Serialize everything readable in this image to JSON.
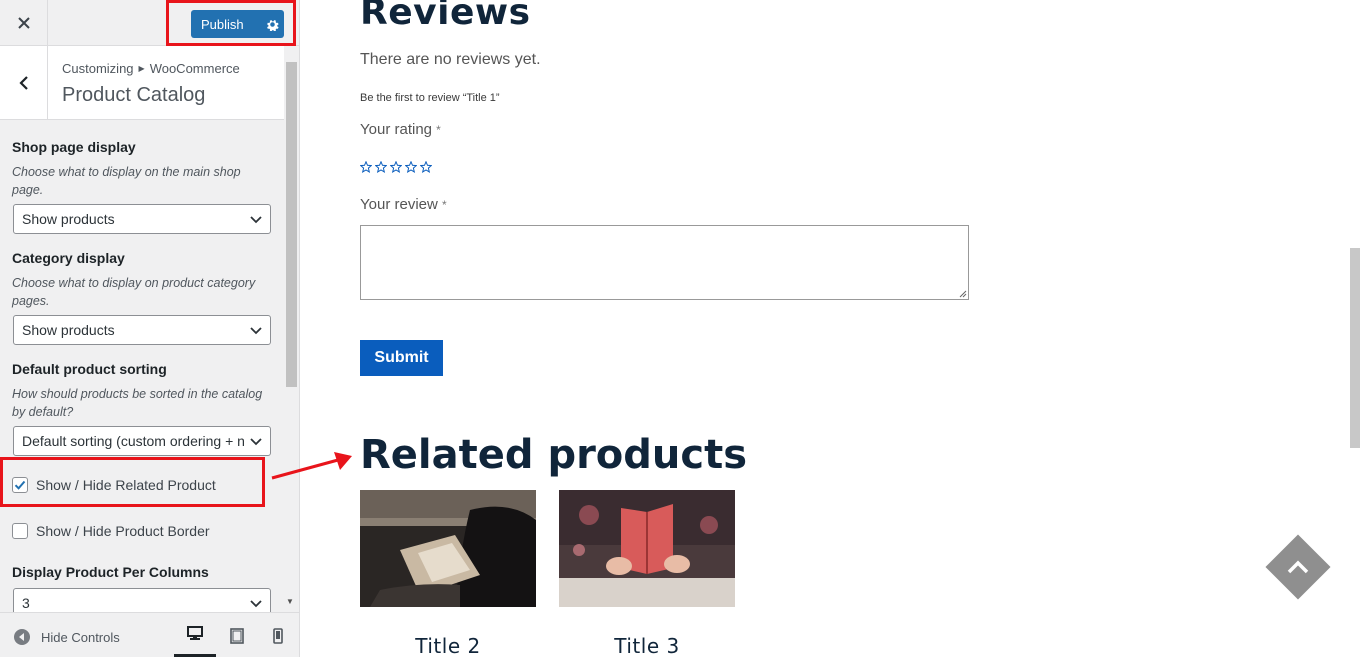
{
  "topbar": {
    "close_icon": "close-icon",
    "publish_label": "Publish",
    "settings_icon": "gear-icon"
  },
  "section": {
    "breadcrumb_root": "Customizing",
    "breadcrumb_parent": "WooCommerce",
    "title": "Product Catalog"
  },
  "controls": {
    "shop_display": {
      "title": "Shop page display",
      "description": "Choose what to display on the main shop page.",
      "value": "Show products"
    },
    "category_display": {
      "title": "Category display",
      "description": "Choose what to display on product category pages.",
      "value": "Show products"
    },
    "sorting": {
      "title": "Default product sorting",
      "description": "How should products be sorted in the catalog by default?",
      "value": "Default sorting (custom ordering + n"
    },
    "related_toggle": {
      "label": "Show / Hide Related Product",
      "checked": true
    },
    "border_toggle": {
      "label": "Show / Hide Product Border",
      "checked": false
    },
    "per_columns": {
      "title": "Display Product Per Columns",
      "value": "3"
    }
  },
  "footer": {
    "hide_controls_label": "Hide Controls",
    "devices": [
      "desktop-icon",
      "tablet-icon",
      "mobile-icon"
    ]
  },
  "preview": {
    "reviews_heading": "Reviews",
    "no_reviews": "There are no reviews yet.",
    "first_review": "Be the first to review “Title 1”",
    "rating_label": "Your rating",
    "review_label": "Your review",
    "required_mark": "*",
    "submit_label": "Submit",
    "related_heading": "Related products",
    "products": [
      {
        "title": "Title 2"
      },
      {
        "title": "Title 3"
      }
    ]
  },
  "colors": {
    "accent": "#2271b1",
    "highlight": "#e8141b",
    "submit": "#0a5dbd",
    "heading": "#10253a"
  }
}
